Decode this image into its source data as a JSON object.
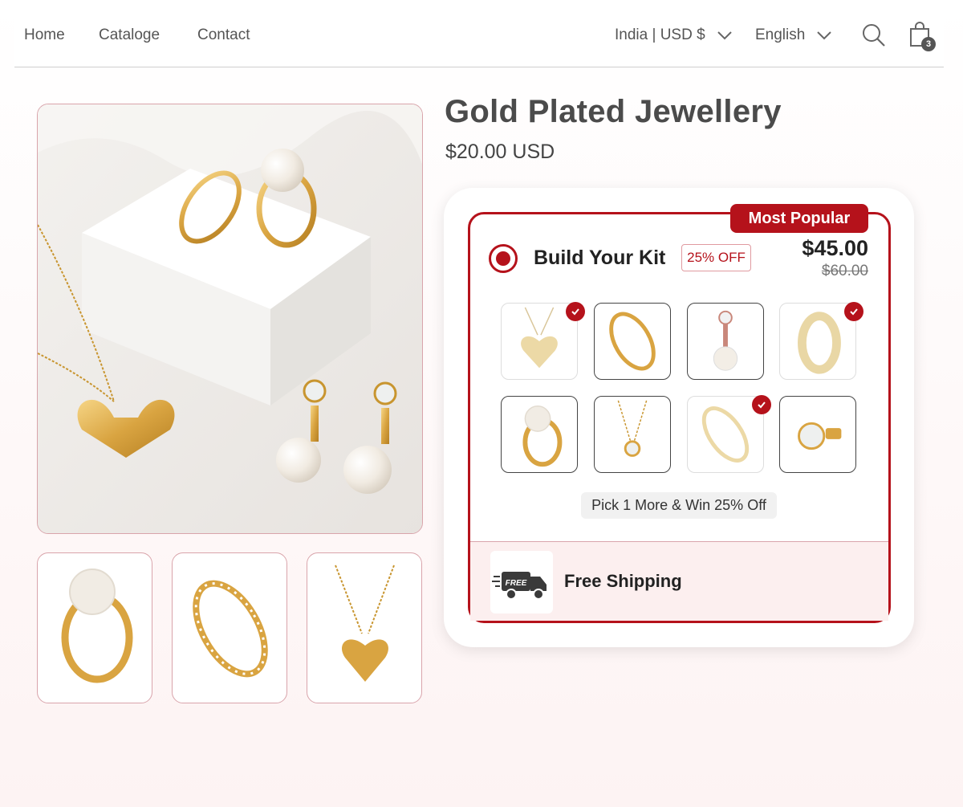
{
  "nav": {
    "links": [
      "Home",
      "Cataloge",
      "Contact"
    ],
    "region": "India | USD $",
    "language": "English",
    "cart_count": "3"
  },
  "product": {
    "title": "Gold Plated Jewellery",
    "price": "$20.00 USD"
  },
  "offer": {
    "ribbon": "Most Popular",
    "title": "Build Your Kit",
    "discount_badge": "25% OFF",
    "price": "$45.00",
    "compare_price": "$60.00",
    "hint": "Pick 1 More & Win 25% Off",
    "shipping_badge": "FREE",
    "shipping_label": "Free Shipping",
    "items": [
      {
        "icon": "heart-pendant-icon",
        "selected": true
      },
      {
        "icon": "diamond-band-ring-icon",
        "selected": false
      },
      {
        "icon": "pearl-drop-earring-icon",
        "selected": false
      },
      {
        "icon": "gold-band-ring-icon",
        "selected": true
      },
      {
        "icon": "pearl-ring-icon",
        "selected": false
      },
      {
        "icon": "solitaire-necklace-icon",
        "selected": false
      },
      {
        "icon": "eternity-ring-icon",
        "selected": true
      },
      {
        "icon": "stud-earrings-icon",
        "selected": false
      }
    ]
  },
  "colors": {
    "accent": "#b5121b",
    "gold": "#d9a441",
    "text": "#333333"
  }
}
